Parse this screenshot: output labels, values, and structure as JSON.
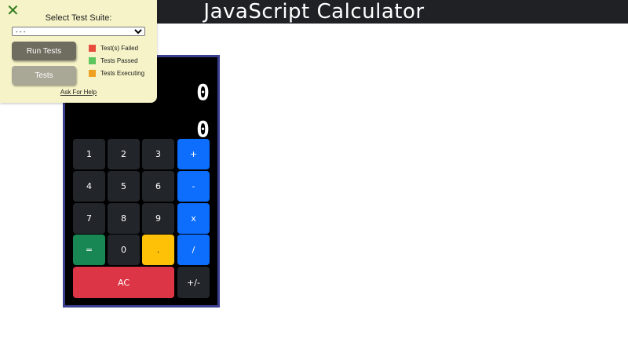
{
  "header": {
    "title": "JavaScript Calculator"
  },
  "calculator": {
    "formula_display": "0",
    "output_display": "0",
    "buttons": {
      "one": "1",
      "two": "2",
      "three": "3",
      "add": "+",
      "four": "4",
      "five": "5",
      "six": "6",
      "subtract": "-",
      "seven": "7",
      "eight": "8",
      "nine": "9",
      "multiply": "x",
      "equals": "=",
      "zero": "0",
      "decimal": ".",
      "divide": "/",
      "clear": "AC",
      "negate": "+/-"
    }
  },
  "test_panel": {
    "close_icon": "close-icon",
    "label": "Select Test Suite:",
    "select_value": "- - -",
    "run_button": "Run Tests",
    "tests_button": "Tests",
    "legend": [
      {
        "label": "Test(s) Failed",
        "color": "#e74c3c"
      },
      {
        "label": "Tests Passed",
        "color": "#5cc55c"
      },
      {
        "label": "Tests Executing",
        "color": "#f0a020"
      }
    ],
    "help_link": "Ask For Help"
  },
  "colors": {
    "topbar": "#1f2124",
    "calc_border": "#3b3f8f",
    "operator": "#0d6efd",
    "equals": "#198754",
    "decimal": "#ffc107",
    "clear": "#dc3545",
    "number": "#22252a"
  }
}
